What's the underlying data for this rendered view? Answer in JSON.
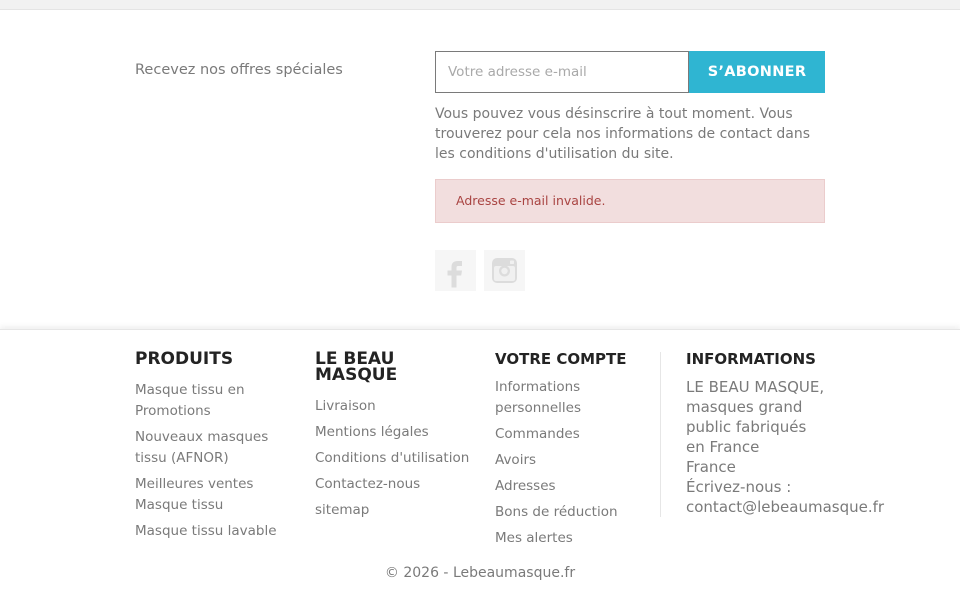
{
  "newsletter": {
    "label": "Recevez nos offres spéciales",
    "email_placeholder": "Votre adresse e-mail",
    "subscribe_label": "S’ABONNER",
    "conditions_text": "Vous pouvez vous désinscrire à tout moment. Vous trouverez pour cela nos informations de contact dans les conditions d'utilisation du site.",
    "alert_text": "Adresse e-mail invalide."
  },
  "social": {
    "icons": [
      "facebook-icon",
      "instagram-icon"
    ]
  },
  "footer": {
    "products": {
      "title": "PRODUITS",
      "links": [
        "Masque tissu en Promotions",
        "Nouveaux masques tissu (AFNOR)",
        "Meilleures ventes Masque tissu",
        "Masque tissu lavable"
      ]
    },
    "company": {
      "title": "LE BEAU MASQUE",
      "links": [
        "Livraison",
        "Mentions légales",
        "Conditions d'utilisation",
        "Contactez-nous",
        "sitemap"
      ]
    },
    "account": {
      "title": "VOTRE COMPTE",
      "links": [
        "Informations personnelles",
        "Commandes",
        "Avoirs",
        "Adresses",
        "Bons de réduction",
        "Mes alertes"
      ]
    },
    "info": {
      "title": "INFORMATIONS",
      "lines": [
        "LE BEAU MASQUE,",
        "masques grand",
        "public fabriqués",
        "en France",
        "France",
        "Écrivez-nous :",
        "contact@lebeaumasque.fr"
      ]
    },
    "copyright": "© 2026 - Lebeaumasque.fr"
  },
  "colors": {
    "accent": "#2fb5d2",
    "alert_bg": "#f2dede",
    "alert_text": "#a94442",
    "heading": "#232323",
    "text": "#7a7a7a"
  }
}
